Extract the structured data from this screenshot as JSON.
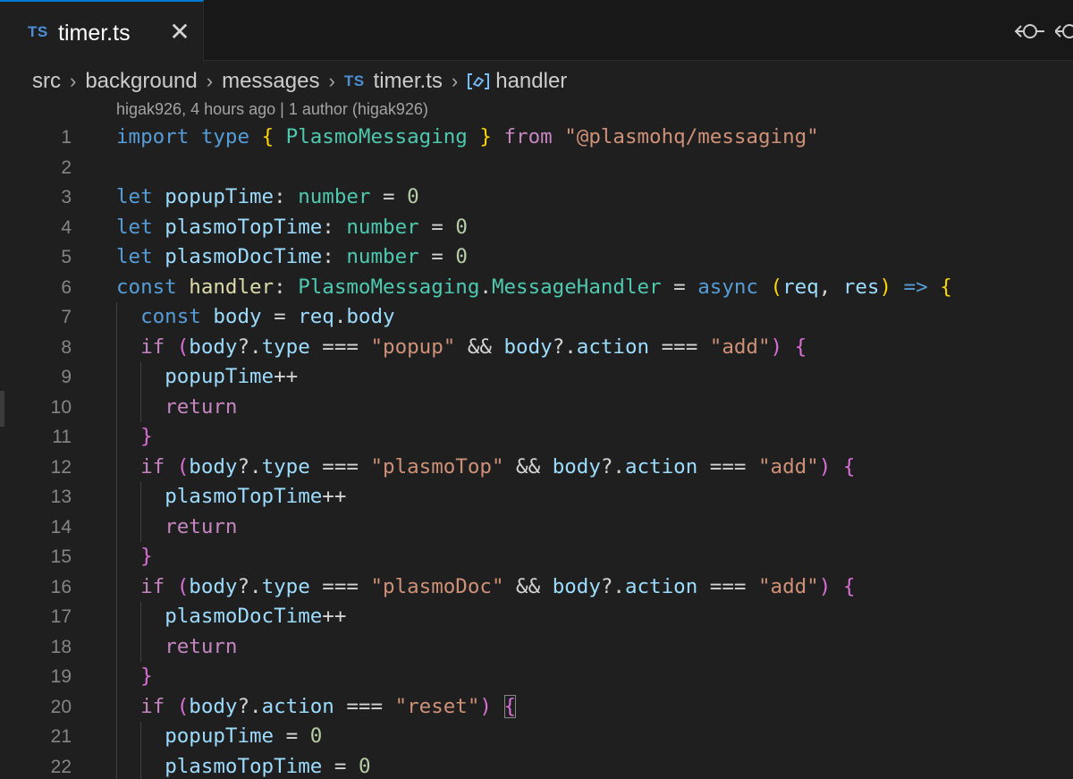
{
  "tab": {
    "icon_label": "TS",
    "title": "timer.ts",
    "close_label": "✕"
  },
  "breadcrumb": [
    "src",
    "background",
    "messages",
    "timer.ts",
    "handler"
  ],
  "breadcrumb_ts_icon": "TS",
  "blame": "higak926, 4 hours ago | 1 author (higak926)",
  "toolbar_icons": [
    "git-compare-icon",
    "git-compare-icon"
  ],
  "colors": {
    "editor_bg": "#1f1f1f",
    "tabbar_bg": "#181818",
    "active_tab_border": "#0078d4",
    "keyword": "#569cd6",
    "control": "#c586c0",
    "variable": "#9cdcfe",
    "type": "#4ec9b0",
    "string": "#ce9178",
    "number": "#b5cea8",
    "function": "#dcdcaa"
  },
  "lines": [
    {
      "n": "1",
      "indent": 0,
      "tokens": [
        [
          "kw",
          "import"
        ],
        [
          "op",
          " "
        ],
        [
          "kw",
          "type"
        ],
        [
          "op",
          " "
        ],
        [
          "b1",
          "{"
        ],
        [
          "op",
          " "
        ],
        [
          "typ",
          "PlasmoMessaging"
        ],
        [
          "op",
          " "
        ],
        [
          "b1",
          "}"
        ],
        [
          "op",
          " "
        ],
        [
          "ctl",
          "from"
        ],
        [
          "op",
          " "
        ],
        [
          "str",
          "\"@plasmohq/messaging\""
        ]
      ]
    },
    {
      "n": "2",
      "indent": 0,
      "tokens": []
    },
    {
      "n": "3",
      "indent": 0,
      "tokens": [
        [
          "kw",
          "let"
        ],
        [
          "op",
          " "
        ],
        [
          "var",
          "popupTime"
        ],
        [
          "op",
          ": "
        ],
        [
          "typ",
          "number"
        ],
        [
          "op",
          " = "
        ],
        [
          "num",
          "0"
        ]
      ]
    },
    {
      "n": "4",
      "indent": 0,
      "tokens": [
        [
          "kw",
          "let"
        ],
        [
          "op",
          " "
        ],
        [
          "var",
          "plasmoTopTime"
        ],
        [
          "op",
          ": "
        ],
        [
          "typ",
          "number"
        ],
        [
          "op",
          " = "
        ],
        [
          "num",
          "0"
        ]
      ]
    },
    {
      "n": "5",
      "indent": 0,
      "tokens": [
        [
          "kw",
          "let"
        ],
        [
          "op",
          " "
        ],
        [
          "var",
          "plasmoDocTime"
        ],
        [
          "op",
          ": "
        ],
        [
          "typ",
          "number"
        ],
        [
          "op",
          " = "
        ],
        [
          "num",
          "0"
        ]
      ]
    },
    {
      "n": "6",
      "indent": 0,
      "tokens": [
        [
          "kw",
          "const"
        ],
        [
          "op",
          " "
        ],
        [
          "fn",
          "handler"
        ],
        [
          "op",
          ": "
        ],
        [
          "typ",
          "PlasmoMessaging"
        ],
        [
          "op",
          "."
        ],
        [
          "typ",
          "MessageHandler"
        ],
        [
          "op",
          " = "
        ],
        [
          "kw",
          "async"
        ],
        [
          "op",
          " "
        ],
        [
          "b1",
          "("
        ],
        [
          "var",
          "req"
        ],
        [
          "op",
          ", "
        ],
        [
          "var",
          "res"
        ],
        [
          "b1",
          ")"
        ],
        [
          "op",
          " "
        ],
        [
          "kw",
          "=>"
        ],
        [
          "op",
          " "
        ],
        [
          "b1",
          "{"
        ]
      ]
    },
    {
      "n": "7",
      "indent": 1,
      "tokens": [
        [
          "kw",
          "const"
        ],
        [
          "op",
          " "
        ],
        [
          "var",
          "body"
        ],
        [
          "op",
          " = "
        ],
        [
          "var",
          "req"
        ],
        [
          "op",
          "."
        ],
        [
          "var",
          "body"
        ]
      ]
    },
    {
      "n": "8",
      "indent": 1,
      "tokens": [
        [
          "ctl",
          "if"
        ],
        [
          "op",
          " "
        ],
        [
          "b2",
          "("
        ],
        [
          "var",
          "body"
        ],
        [
          "op",
          "?."
        ],
        [
          "var",
          "type"
        ],
        [
          "op",
          " === "
        ],
        [
          "str",
          "\"popup\""
        ],
        [
          "op",
          " && "
        ],
        [
          "var",
          "body"
        ],
        [
          "op",
          "?."
        ],
        [
          "var",
          "action"
        ],
        [
          "op",
          " === "
        ],
        [
          "str",
          "\"add\""
        ],
        [
          "b2",
          ")"
        ],
        [
          "op",
          " "
        ],
        [
          "b2",
          "{"
        ]
      ]
    },
    {
      "n": "9",
      "indent": 2,
      "tokens": [
        [
          "var",
          "popupTime"
        ],
        [
          "op",
          "++"
        ]
      ]
    },
    {
      "n": "10",
      "indent": 2,
      "tokens": [
        [
          "ctl",
          "return"
        ]
      ]
    },
    {
      "n": "11",
      "indent": 1,
      "tokens": [
        [
          "b2",
          "}"
        ]
      ]
    },
    {
      "n": "12",
      "indent": 1,
      "tokens": [
        [
          "ctl",
          "if"
        ],
        [
          "op",
          " "
        ],
        [
          "b2",
          "("
        ],
        [
          "var",
          "body"
        ],
        [
          "op",
          "?."
        ],
        [
          "var",
          "type"
        ],
        [
          "op",
          " === "
        ],
        [
          "str",
          "\"plasmoTop\""
        ],
        [
          "op",
          " && "
        ],
        [
          "var",
          "body"
        ],
        [
          "op",
          "?."
        ],
        [
          "var",
          "action"
        ],
        [
          "op",
          " === "
        ],
        [
          "str",
          "\"add\""
        ],
        [
          "b2",
          ")"
        ],
        [
          "op",
          " "
        ],
        [
          "b2",
          "{"
        ]
      ]
    },
    {
      "n": "13",
      "indent": 2,
      "tokens": [
        [
          "var",
          "plasmoTopTime"
        ],
        [
          "op",
          "++"
        ]
      ]
    },
    {
      "n": "14",
      "indent": 2,
      "tokens": [
        [
          "ctl",
          "return"
        ]
      ]
    },
    {
      "n": "15",
      "indent": 1,
      "tokens": [
        [
          "b2",
          "}"
        ]
      ]
    },
    {
      "n": "16",
      "indent": 1,
      "tokens": [
        [
          "ctl",
          "if"
        ],
        [
          "op",
          " "
        ],
        [
          "b2",
          "("
        ],
        [
          "var",
          "body"
        ],
        [
          "op",
          "?."
        ],
        [
          "var",
          "type"
        ],
        [
          "op",
          " === "
        ],
        [
          "str",
          "\"plasmoDoc\""
        ],
        [
          "op",
          " && "
        ],
        [
          "var",
          "body"
        ],
        [
          "op",
          "?."
        ],
        [
          "var",
          "action"
        ],
        [
          "op",
          " === "
        ],
        [
          "str",
          "\"add\""
        ],
        [
          "b2",
          ")"
        ],
        [
          "op",
          " "
        ],
        [
          "b2",
          "{"
        ]
      ]
    },
    {
      "n": "17",
      "indent": 2,
      "tokens": [
        [
          "var",
          "plasmoDocTime"
        ],
        [
          "op",
          "++"
        ]
      ]
    },
    {
      "n": "18",
      "indent": 2,
      "tokens": [
        [
          "ctl",
          "return"
        ]
      ]
    },
    {
      "n": "19",
      "indent": 1,
      "tokens": [
        [
          "b2",
          "}"
        ]
      ]
    },
    {
      "n": "20",
      "indent": 1,
      "tokens": [
        [
          "ctl",
          "if"
        ],
        [
          "op",
          " "
        ],
        [
          "b2",
          "("
        ],
        [
          "var",
          "body"
        ],
        [
          "op",
          "?."
        ],
        [
          "var",
          "action"
        ],
        [
          "op",
          " === "
        ],
        [
          "str",
          "\"reset\""
        ],
        [
          "b2",
          ")"
        ],
        [
          "op",
          " "
        ],
        [
          "b2 bm",
          "{"
        ]
      ]
    },
    {
      "n": "21",
      "indent": 2,
      "tokens": [
        [
          "var",
          "popupTime"
        ],
        [
          "op",
          " = "
        ],
        [
          "num",
          "0"
        ]
      ]
    },
    {
      "n": "22",
      "indent": 2,
      "tokens": [
        [
          "var",
          "plasmoTopTime"
        ],
        [
          "op",
          " = "
        ],
        [
          "num",
          "0"
        ]
      ]
    }
  ]
}
